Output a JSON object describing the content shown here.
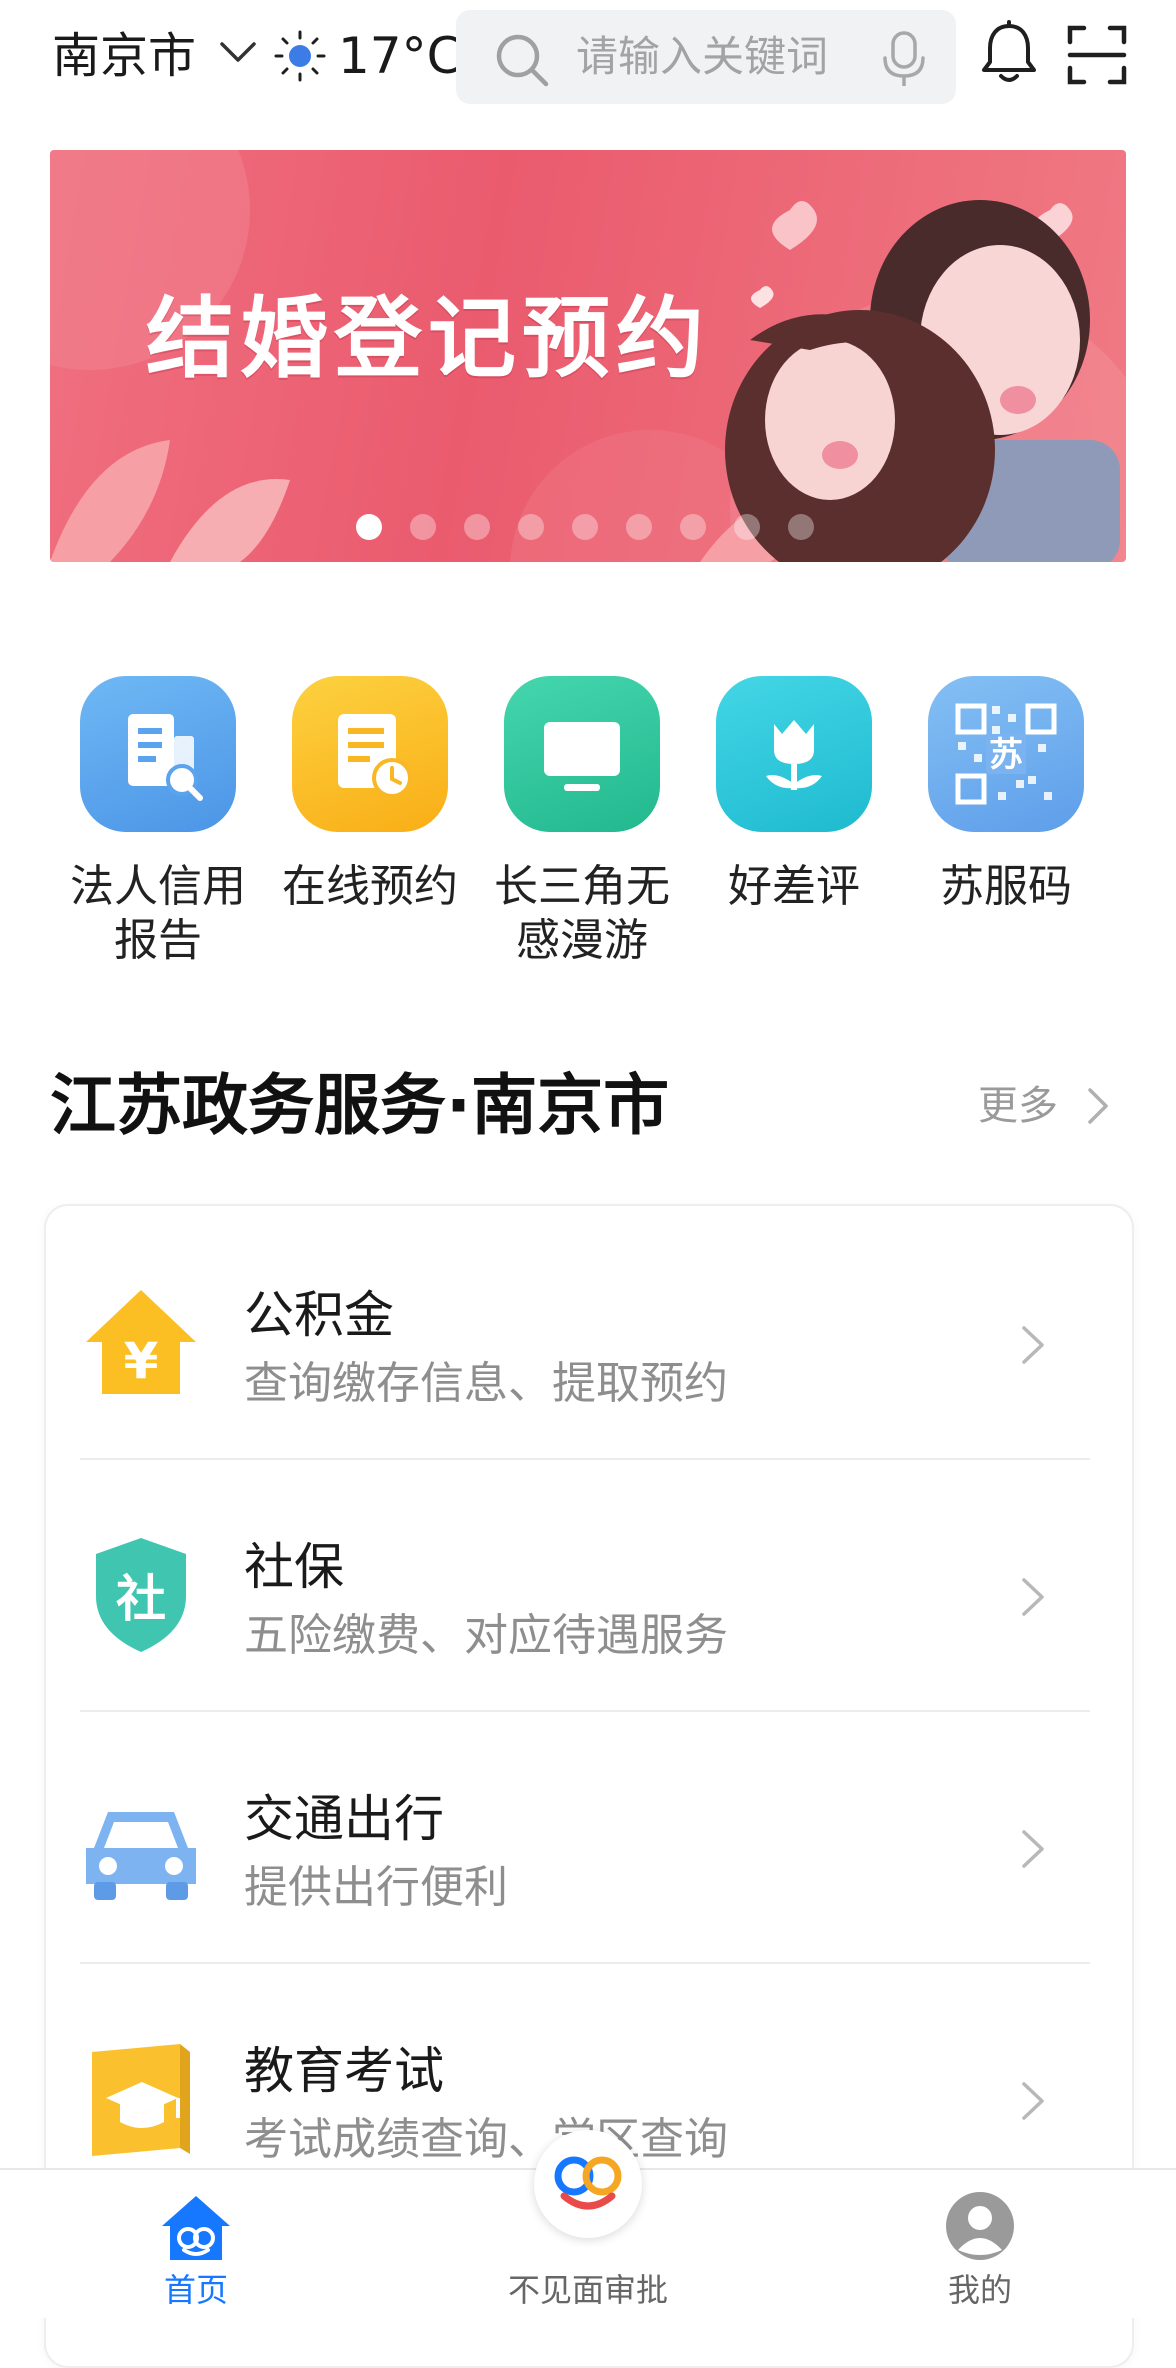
{
  "header": {
    "city": "南京市",
    "temperature": "17°C",
    "weather_icon": "sun-cloud-icon",
    "search": {
      "placeholder": "请输入关键词"
    }
  },
  "banner": {
    "title": "结婚登记预约",
    "slide_count": 9,
    "active_slide": 1
  },
  "quick_services": [
    {
      "label": "法人信用\n报告",
      "icon": "credit-report-icon",
      "color": "#5da8ef"
    },
    {
      "label": "在线预约",
      "icon": "appointment-icon",
      "color": "#fbc22a"
    },
    {
      "label": "长三角无\n感漫游",
      "icon": "monitor-icon",
      "color": "#34c9a2"
    },
    {
      "label": "好差评",
      "icon": "tulip-icon",
      "color": "#31c8d9"
    },
    {
      "label": "苏服码",
      "icon": "qr-code-icon",
      "color": "#6faef0"
    }
  ],
  "section": {
    "title": "江苏政务服务·南京市",
    "more_label": "更多"
  },
  "services": [
    {
      "title": "公积金",
      "desc": "查询缴存信息、提取预约",
      "icon": "house-yuan-icon"
    },
    {
      "title": "社保",
      "desc": "五险缴费、对应待遇服务",
      "icon": "shield-she-icon"
    },
    {
      "title": "交通出行",
      "desc": "提供出行便利",
      "icon": "car-icon"
    },
    {
      "title": "教育考试",
      "desc": "考试成绩查询、学区查询",
      "icon": "book-graduation-icon"
    }
  ],
  "bottom_nav": {
    "items": [
      {
        "label": "首页",
        "icon": "home-icon",
        "active": true
      },
      {
        "label": "不见面审批",
        "icon": "approval-logo-icon",
        "active": false
      },
      {
        "label": "我的",
        "icon": "user-icon",
        "active": false
      }
    ]
  },
  "colors": {
    "accent": "#1677ff",
    "banner": "#ea5b6e"
  }
}
